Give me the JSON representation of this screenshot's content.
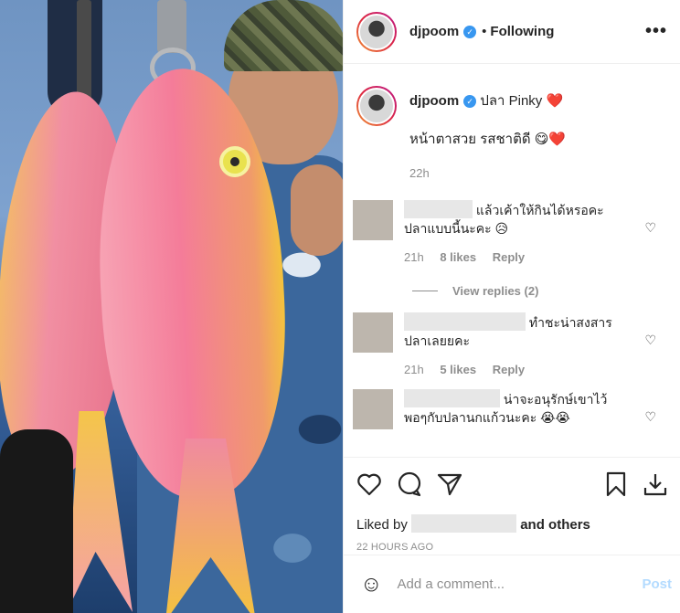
{
  "header": {
    "username": "djpoom",
    "separator": "•",
    "follow_status": "Following",
    "more": "•••"
  },
  "caption": {
    "username": "djpoom",
    "title": "ปลา Pinky ❤️",
    "text": "หน้าตาสวย รสชาติดี 😋❤️",
    "time": "22h"
  },
  "comments": [
    {
      "text_line1": "แล้วเค้าให้กินได้หรอคะ",
      "text_line2": "ปลาแบบนี้นะคะ 😥",
      "time": "21h",
      "likes": "8 likes",
      "reply": "Reply",
      "view_replies": "View replies (2)"
    },
    {
      "text_line1": "ทำชะน่าสงสาร",
      "text_line2": "ปลาเลยยคะ",
      "time": "21h",
      "likes": "5 likes",
      "reply": "Reply"
    },
    {
      "text_line1": "น่าจะอนุรักษ์เขาไว้",
      "text_line2": "พอๆกับปลานกแก้วนะคะ 😭😭"
    }
  ],
  "actions": {
    "liked_prefix": "Liked by",
    "liked_suffix": "and others",
    "time_ago": "22 HOURS AGO"
  },
  "add_comment": {
    "placeholder": "Add a comment...",
    "post": "Post"
  },
  "icons": [
    "heart-icon",
    "comment-icon",
    "share-icon",
    "bookmark-icon",
    "download-icon",
    "emoji-icon",
    "verified-icon"
  ],
  "colors": {
    "verified": "#3897f0",
    "muted": "#8e8e8e",
    "post_disabled": "#b3dbff"
  }
}
